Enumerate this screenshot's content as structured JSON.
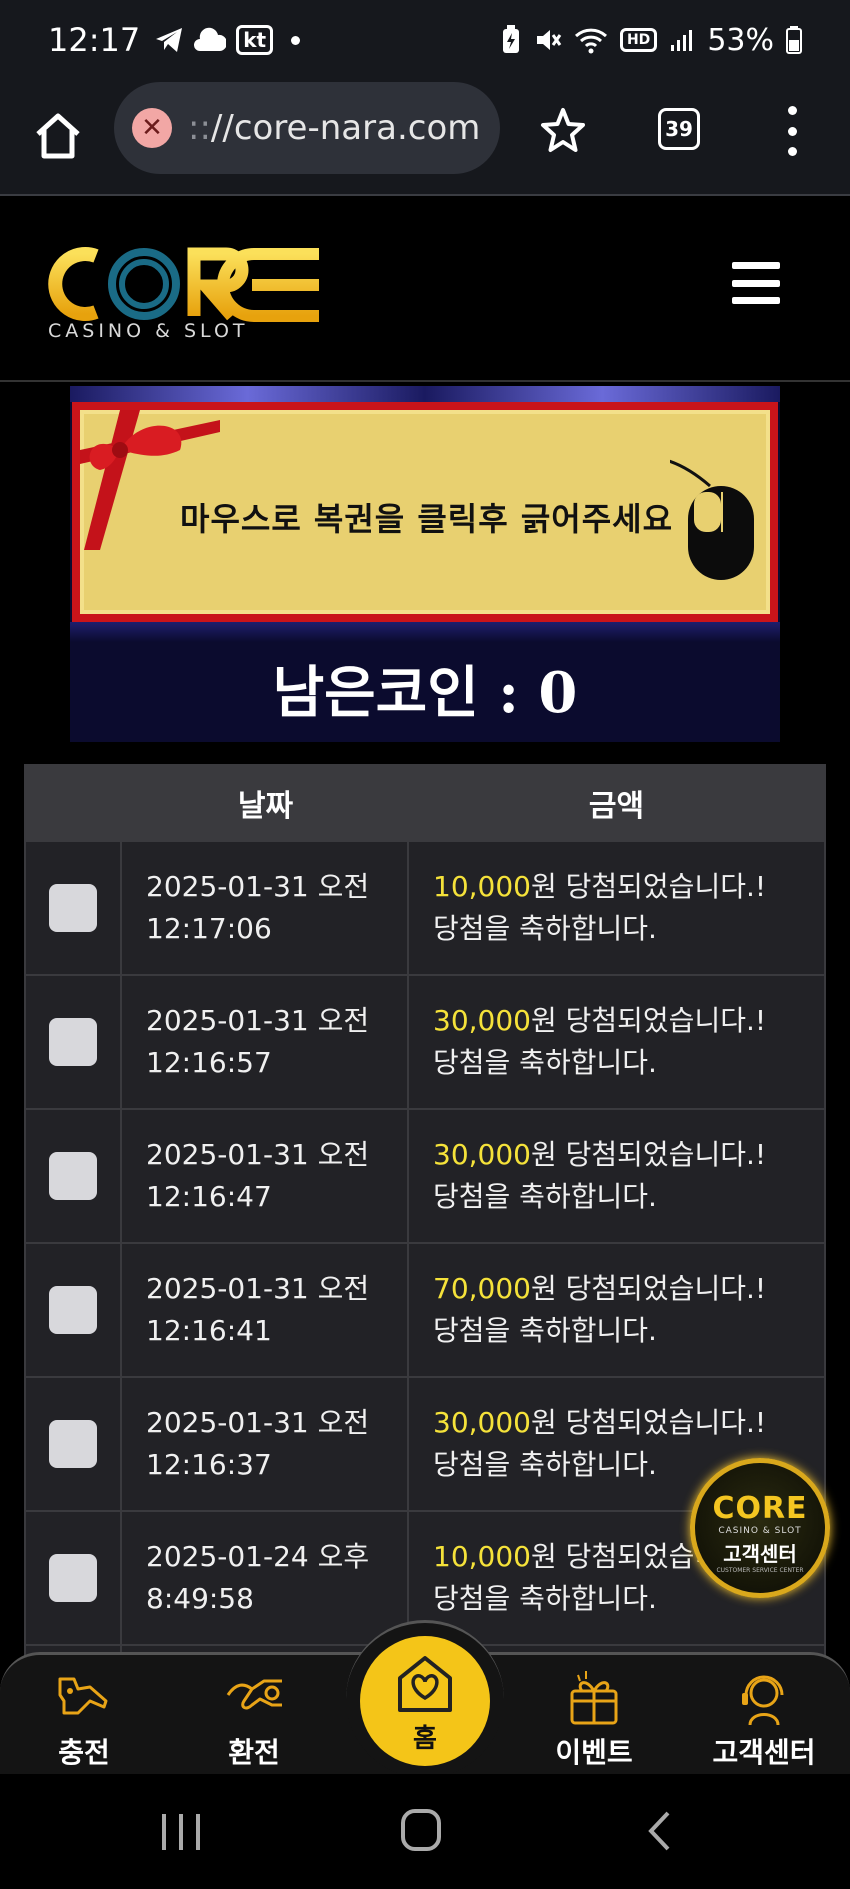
{
  "status_bar": {
    "time": "12:17",
    "carrier": "kt",
    "battery": "53%",
    "hd_label": "HD"
  },
  "browser": {
    "url_faded": "::",
    "url": "//core-nara.com",
    "tab_count": "39"
  },
  "site": {
    "logo_text": "CORE",
    "logo_subtitle": "CASINO & SLOT"
  },
  "banner": {
    "instruction": "마우스로 복권을 클릭후 긁어주세요",
    "coins_label": "남은코인 : 0"
  },
  "table": {
    "headers": {
      "date": "날짜",
      "amount": "금액"
    },
    "rows": [
      {
        "date": "2025-01-31 오전",
        "time": "12:17:06",
        "amount": "10,000",
        "message": "원 당첨되었습니다.! 당첨을 축하합니다."
      },
      {
        "date": "2025-01-31 오전",
        "time": "12:16:57",
        "amount": "30,000",
        "message": "원 당첨되었습니다.! 당첨을 축하합니다."
      },
      {
        "date": "2025-01-31 오전",
        "time": "12:16:47",
        "amount": "30,000",
        "message": "원 당첨되었습니다.! 당첨을 축하합니다."
      },
      {
        "date": "2025-01-31 오전",
        "time": "12:16:41",
        "amount": "70,000",
        "message": "원 당첨되었습니다.! 당첨을 축하합니다."
      },
      {
        "date": "2025-01-31 오전",
        "time": "12:16:37",
        "amount": "30,000",
        "message": "원 당첨되었습니다.! 당첨을 축하합니다."
      },
      {
        "date": "2025-01-24 오후",
        "time": "8:49:58",
        "amount": "10,000",
        "message": "원 당첨되었습니다.! 당첨을 축하합니다."
      }
    ]
  },
  "floating_support": {
    "logo": "CORE",
    "subtitle": "CASINO & SLOT",
    "label": "고객센터",
    "english": "CUSTOMER SERVICE CENTER"
  },
  "bottom_nav": {
    "deposit": "충전",
    "withdraw": "환전",
    "home": "홈",
    "event": "이벤트",
    "support": "고객센터"
  },
  "colors": {
    "accent_yellow": "#f4c518",
    "amount_yellow": "#f5e23a",
    "banner_red": "#c9141a"
  }
}
